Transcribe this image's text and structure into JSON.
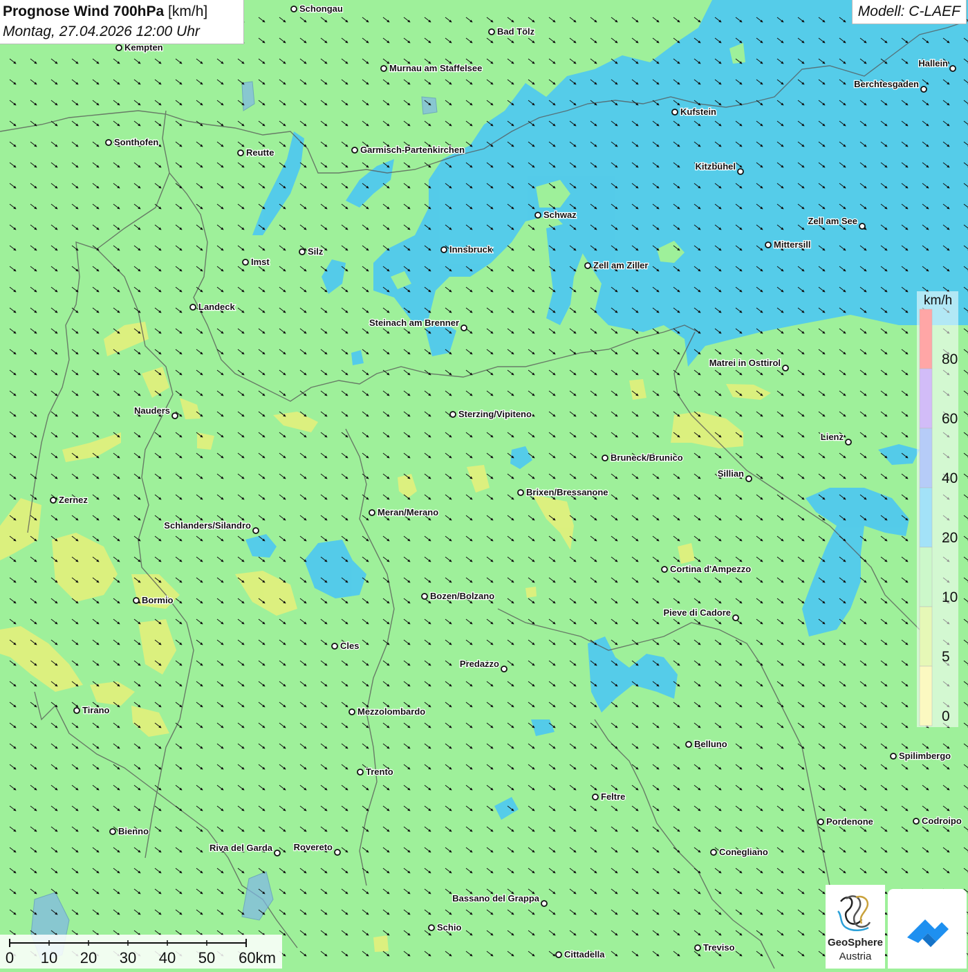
{
  "title": {
    "name": "Prognose Wind 700hPa",
    "unit": "[km/h]",
    "datetime": "Montag, 27.04.2026 12:00 Uhr"
  },
  "model": "Modell: C-LAEF",
  "legend": {
    "unit": "km/h",
    "values": [
      "80",
      "60",
      "40",
      "20",
      "10",
      "5",
      "0"
    ],
    "colors": [
      "#ff3b3b",
      "#9b6bf0",
      "#5e8ef0",
      "#33bff0",
      "#8ef08a",
      "#c8f060",
      "#f6f275"
    ]
  },
  "scale": {
    "labels": [
      "0",
      "10",
      "20",
      "30",
      "40",
      "50",
      "60km"
    ]
  },
  "logo": {
    "name_line1": "GeoSphere",
    "name_line2": "Austria"
  },
  "cities": [
    "Schongau",
    "Bad Tölz",
    "Kempten",
    "Murnau am Staffelsee",
    "Hallein",
    "Berchtesgaden",
    "Kufstein",
    "Sonthofen",
    "Reutte",
    "Garmisch-Partenkirchen",
    "Kitzbühel",
    "Schwaz",
    "Zell am See",
    "Silz",
    "Innsbruck",
    "Mittersill",
    "Imst",
    "Zell am Ziller",
    "Landeck",
    "Steinach am Brenner",
    "Matrei in Osttirol",
    "Nauders",
    "Sterzing/Vipiteno",
    "Lienz",
    "Bruneck/Brunico",
    "Sillian",
    "Brixen/Bressanone",
    "Zernez",
    "Meran/Merano",
    "Schlanders/Silandro",
    "Cortina d'Ampezzo",
    "Bozen/Bolzano",
    "Bormio",
    "Pieve di Cadore",
    "Cles",
    "Predazzo",
    "Tirano",
    "Mezzolombardo",
    "Belluno",
    "Spilimbergo",
    "Trento",
    "Feltre",
    "Pordenone",
    "Codroipo",
    "Bienno",
    "Riva del Garda",
    "Rovereto",
    "Conegliano",
    "Bassano del Grappa",
    "Schio",
    "Treviso",
    "Cittadella"
  ]
}
